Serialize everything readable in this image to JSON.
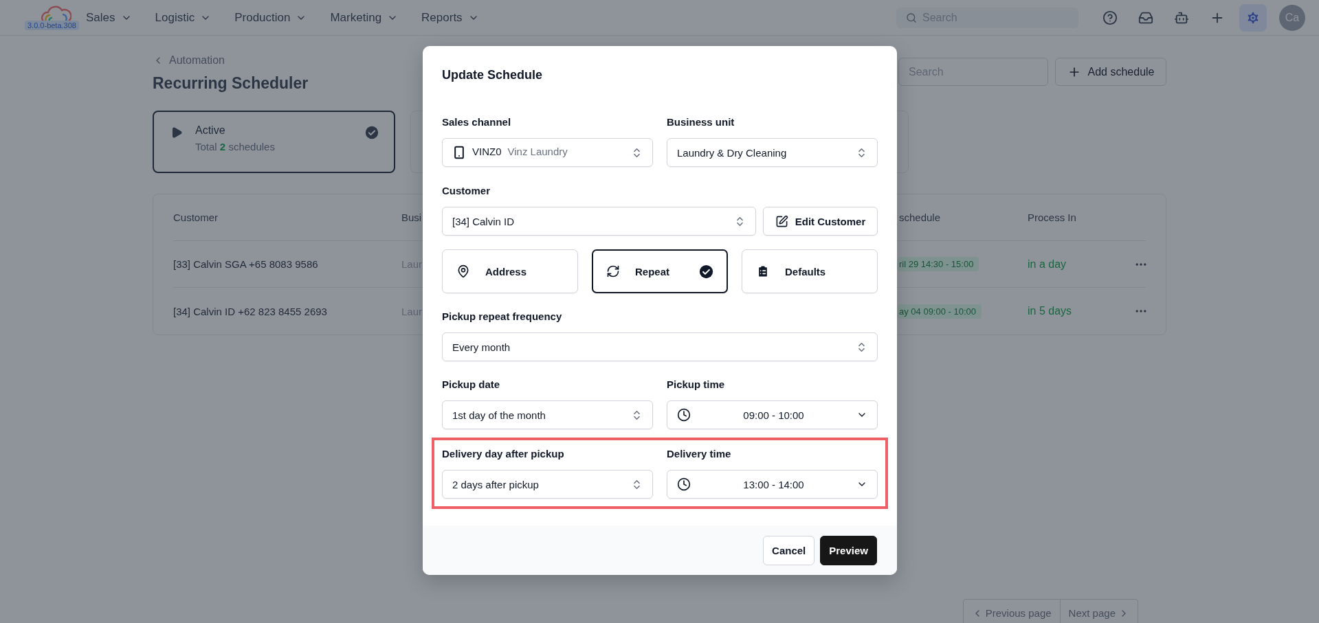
{
  "app": {
    "version": "3.0.0-beta.308",
    "nav": [
      "Sales",
      "Logistic",
      "Production",
      "Marketing",
      "Reports"
    ],
    "search": {
      "placeholder": "Search"
    },
    "avatar": "Ca"
  },
  "page": {
    "breadcrumb": "Automation",
    "title": "Recurring Scheduler",
    "search": {
      "placeholder": "Search"
    },
    "add_button": "Add schedule",
    "status_cards": [
      {
        "title": "Active",
        "total": "Total",
        "count": "2",
        "unit": "schedules",
        "selected": true
      },
      {
        "selected": false
      }
    ],
    "table": {
      "columns": [
        "Customer",
        "Busi",
        "schedule",
        "Process In"
      ],
      "rows": [
        {
          "customer": "[33] Calvin SGA +65 8083 9586",
          "business": "Laur",
          "schedule": "ril 29 14:30 - 15:00",
          "process_in": "in a day"
        },
        {
          "customer": "[34] Calvin ID +62 823 8455 2693",
          "business": "Laur",
          "schedule": "ay 04 09:00 - 10:00",
          "process_in": "in 5 days"
        }
      ]
    },
    "pagination": [
      "Previous page",
      "Next page"
    ]
  },
  "dialog": {
    "title": "Update Schedule",
    "sales_channel": {
      "label": "Sales channel",
      "code": "VINZ0",
      "name": "Vinz Laundry"
    },
    "business_unit": {
      "label": "Business unit",
      "value": "Laundry & Dry Cleaning"
    },
    "customer": {
      "label": "Customer",
      "value": "[34] Calvin ID",
      "edit_button": "Edit Customer"
    },
    "options": [
      {
        "label": "Address",
        "selected": false
      },
      {
        "label": "Repeat",
        "selected": true
      },
      {
        "label": "Defaults",
        "selected": false
      }
    ],
    "repeat_frequency": {
      "label": "Pickup repeat frequency",
      "value": "Every month"
    },
    "pickup_date": {
      "label": "Pickup date",
      "value": "1st day of the month"
    },
    "pickup_time": {
      "label": "Pickup time",
      "value": "09:00 - 10:00"
    },
    "delivery": {
      "highlighted": true,
      "day": {
        "label": "Delivery day after pickup",
        "value": "2 days after pickup"
      },
      "time": {
        "label": "Delivery time",
        "value": "13:00 - 14:00"
      }
    },
    "buttons": [
      {
        "label": "Cancel",
        "kind": "secondary"
      },
      {
        "label": "Preview",
        "kind": "primary"
      }
    ]
  }
}
